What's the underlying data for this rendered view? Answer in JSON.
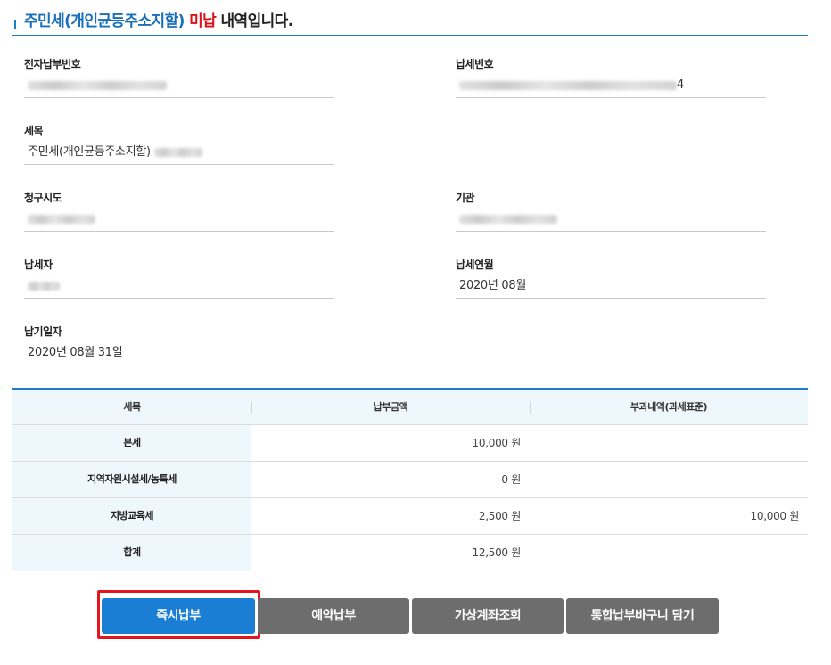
{
  "header": {
    "title_part1": "주민세(개인균등주소지할)",
    "title_part2": " 미납",
    "title_part3": " 내역입니다."
  },
  "fields": {
    "epay_no": {
      "label": "전자납부번호",
      "value": ""
    },
    "tax_no": {
      "label": "납세번호",
      "value_suffix": "4"
    },
    "item": {
      "label": "세목",
      "value": "주민세(개인균등주소지할)"
    },
    "region": {
      "label": "청구시도",
      "value": ""
    },
    "agency": {
      "label": "기관",
      "value": ""
    },
    "payer": {
      "label": "납세자",
      "value": ""
    },
    "tax_month": {
      "label": "납세연월",
      "value": "2020년 08월"
    },
    "due_date": {
      "label": "납기일자",
      "value": "2020년 08월 31일"
    }
  },
  "table": {
    "headers": [
      "세목",
      "납부금액",
      "부과내역(과세표준)"
    ],
    "rows": [
      {
        "name": "본세",
        "amount": "10,000 원",
        "base": ""
      },
      {
        "name": "지역자원시설세/농특세",
        "amount": "0 원",
        "base": ""
      },
      {
        "name": "지방교육세",
        "amount": "2,500 원",
        "base": "10,000 원"
      },
      {
        "name": "합계",
        "amount": "12,500 원",
        "base": ""
      }
    ]
  },
  "buttons": {
    "pay_now": "즉시납부",
    "reserve_pay": "예약납부",
    "virtual_account": "가상계좌조회",
    "add_cart": "통합납부바구니 담기"
  },
  "colors": {
    "accent": "#1a7fc7",
    "unpaid_red": "#d8131b",
    "primary_button": "#1a7fd4",
    "secondary_button": "#6d6d6d",
    "highlight_box": "#e5141f"
  }
}
